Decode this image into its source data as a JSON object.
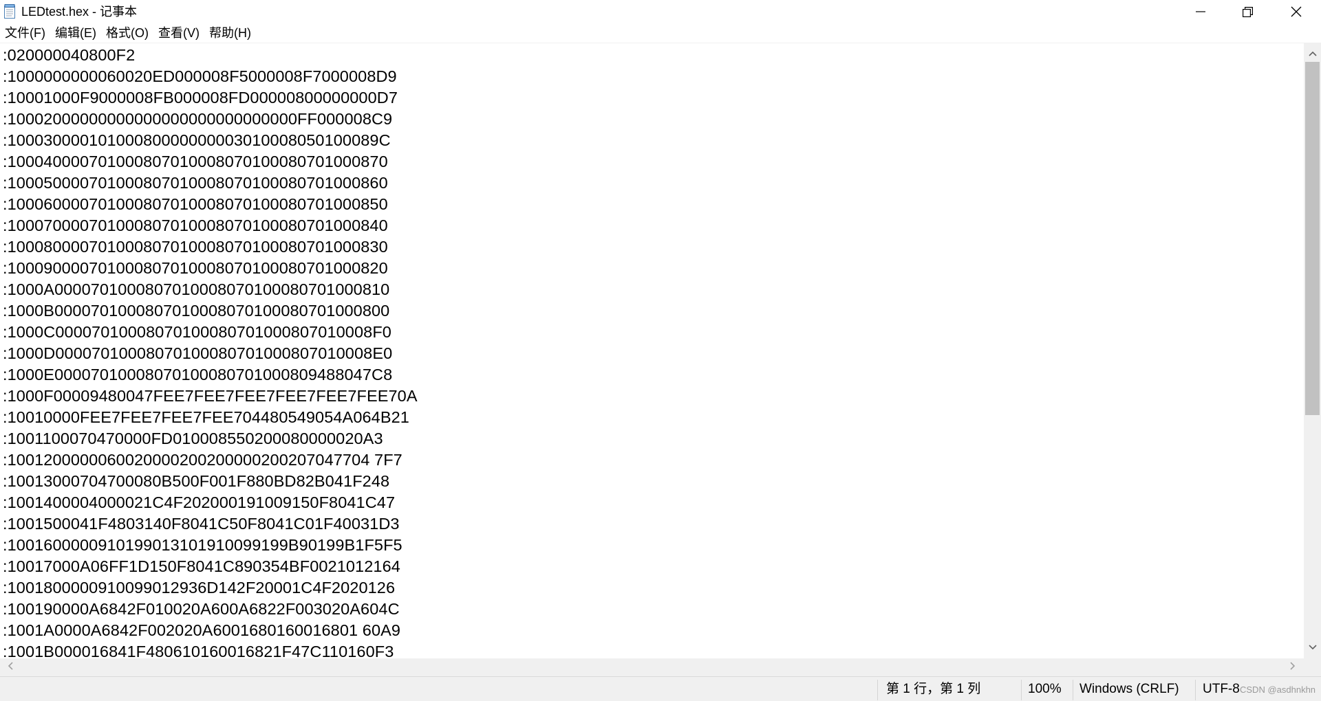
{
  "window": {
    "title": "LEDtest.hex - 记事本"
  },
  "menu": [
    {
      "label": "文件(F)"
    },
    {
      "label": "编辑(E)"
    },
    {
      "label": "格式(O)"
    },
    {
      "label": "查看(V)"
    },
    {
      "label": "帮助(H)"
    }
  ],
  "editor": {
    "lines": [
      ":020000040800F2",
      ":1000000000060020ED000008F5000008F7000008D9",
      ":10001000F9000008FB000008FD00000800000000D7",
      ":10002000000000000000000000000000FF000008C9",
      ":10003000010100080000000003010008050100089C",
      ":100040000701000807010008070100080701000870",
      ":100050000701000807010008070100080701000860",
      ":100060000701000807010008070100080701000850",
      ":100070000701000807010008070100080701000840",
      ":100080000701000807010008070100080701000830",
      ":100090000701000807010008070100080701000820",
      ":1000A0000701000807010008070100080701000810",
      ":1000B0000701000807010008070100080701000800",
      ":1000C00007010008070100080701000807010008F0",
      ":1000D00007010008070100080701000807010008E0",
      ":1000E00007010008070100080701000809488047C8",
      ":1000F00009480047FEE7FEE7FEE7FEE7FEE7FEE70A",
      ":10010000FEE7FEE7FEE7FEE704480549054A064B21",
      ":1001100070470000FD010008550200080000020A3",
      ":1001200000060020000200200000200207047704 7F7",
      ":10013000704700080B500F001F880BD82B041F248",
      ":1001400004000021C4F202000191009150F8041C47",
      ":1001500041F4803140F8041C50F8041C01F40031D3",
      ":1001600000910199013101910099199B90199B1F5F5",
      ":10017000A06FF1D150F8041C890354BF0021012164",
      ":1001800000910099012936D142F20001C4F2020126",
      ":100190000A6842F010020A600A6822F003020A604C",
      ":1001A0000A6842F002020A6001680160016801 60A9",
      ":1001B000016841F480610160016821F47C110160F3"
    ]
  },
  "status": {
    "position": "第 1 行，第 1 列",
    "zoom": "100%",
    "line_ending": "Windows (CRLF)",
    "encoding": "UTF-8",
    "watermark": "CSDN @asdhnkhn"
  },
  "icons": {
    "app": "notepad-icon",
    "minimize": "minimize-icon",
    "maximize": "restore-icon",
    "close": "close-icon"
  }
}
